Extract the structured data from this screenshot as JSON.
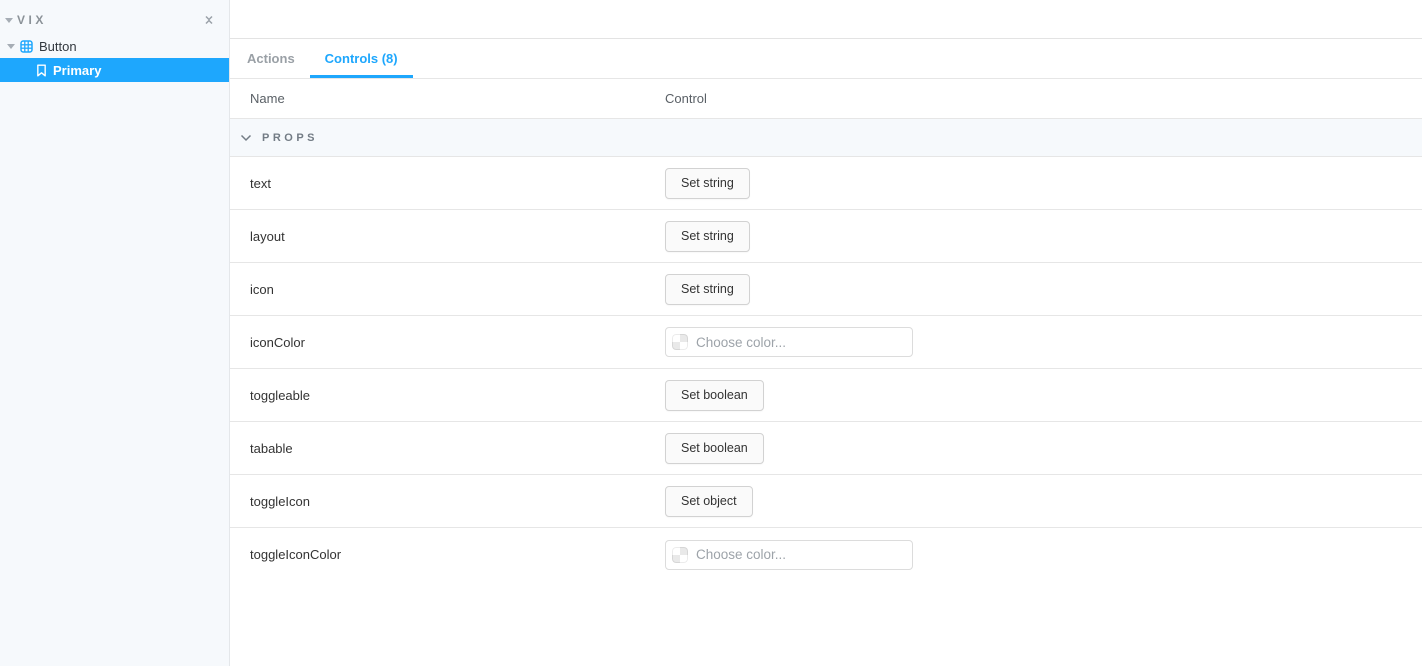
{
  "colors": {
    "accent": "#1ea7fd",
    "sidebar_bg": "#f6f9fc",
    "section_bg": "#f6f9fc",
    "border": "#e6e6e6"
  },
  "icons": {
    "brand_expander": "chevron-down",
    "sidebar_collapse": "collapse-vertical-chevrons",
    "component": "grid",
    "story": "bookmark",
    "section_expander": "chevron-down",
    "color_swatch": "transparent-checkerboard"
  },
  "sidebar": {
    "title": "VIX",
    "items": [
      {
        "label": "Button",
        "type": "component",
        "expanded": true,
        "selected": false
      },
      {
        "label": "Primary",
        "type": "story",
        "selected": true
      }
    ]
  },
  "panel": {
    "tabs": [
      {
        "label": "Actions",
        "active": false
      },
      {
        "label": "Controls (8)",
        "active": true
      }
    ],
    "table": {
      "headers": [
        "Name",
        "Control"
      ],
      "section": "PROPS",
      "rows": [
        {
          "name": "text",
          "control": "Set string",
          "control_type": "button"
        },
        {
          "name": "layout",
          "control": "Set string",
          "control_type": "button"
        },
        {
          "name": "icon",
          "control": "Set string",
          "control_type": "button"
        },
        {
          "name": "iconColor",
          "control": "Choose color...",
          "control_type": "color"
        },
        {
          "name": "toggleable",
          "control": "Set boolean",
          "control_type": "button"
        },
        {
          "name": "tabable",
          "control": "Set boolean",
          "control_type": "button"
        },
        {
          "name": "toggleIcon",
          "control": "Set object",
          "control_type": "button"
        },
        {
          "name": "toggleIconColor",
          "control": "Choose color...",
          "control_type": "color"
        }
      ]
    }
  }
}
